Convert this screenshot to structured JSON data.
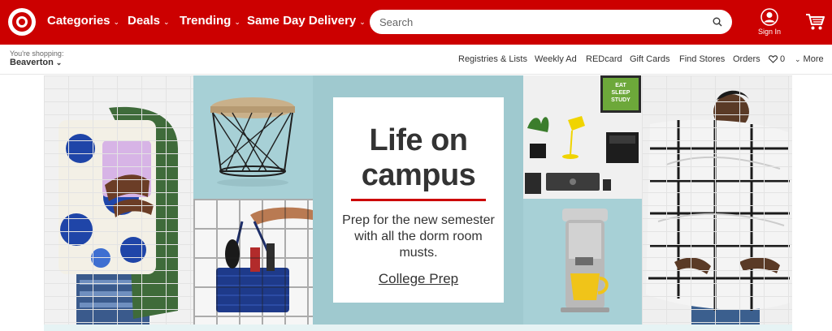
{
  "header": {
    "nav": [
      {
        "label": "Categories"
      },
      {
        "label": "Deals"
      },
      {
        "label": "Trending"
      },
      {
        "label": "Same Day Delivery"
      }
    ],
    "search": {
      "placeholder": "Search"
    },
    "signin_label": "Sign In"
  },
  "subbar": {
    "shopping_label": "You're shopping:",
    "store": "Beaverton",
    "links": {
      "registries": "Registries & Lists",
      "weekly_ad": "Weekly Ad",
      "redcard": "REDcard",
      "gift_cards": "Gift Cards",
      "find_stores": "Find Stores",
      "orders": "Orders",
      "favorites_count": "0",
      "more": "More"
    }
  },
  "hero": {
    "title": "Life on campus",
    "body": "Prep for the new semester with all the dorm room musts.",
    "link": "College Prep",
    "letterboard": "EAT SLEEP STUDY"
  },
  "colors": {
    "brand_red": "#cc0000",
    "hero_teal": "#9fc9cf"
  },
  "icons": [
    "target-logo",
    "chevron-down-icon",
    "search-icon",
    "account-icon",
    "cart-icon",
    "heart-icon"
  ]
}
